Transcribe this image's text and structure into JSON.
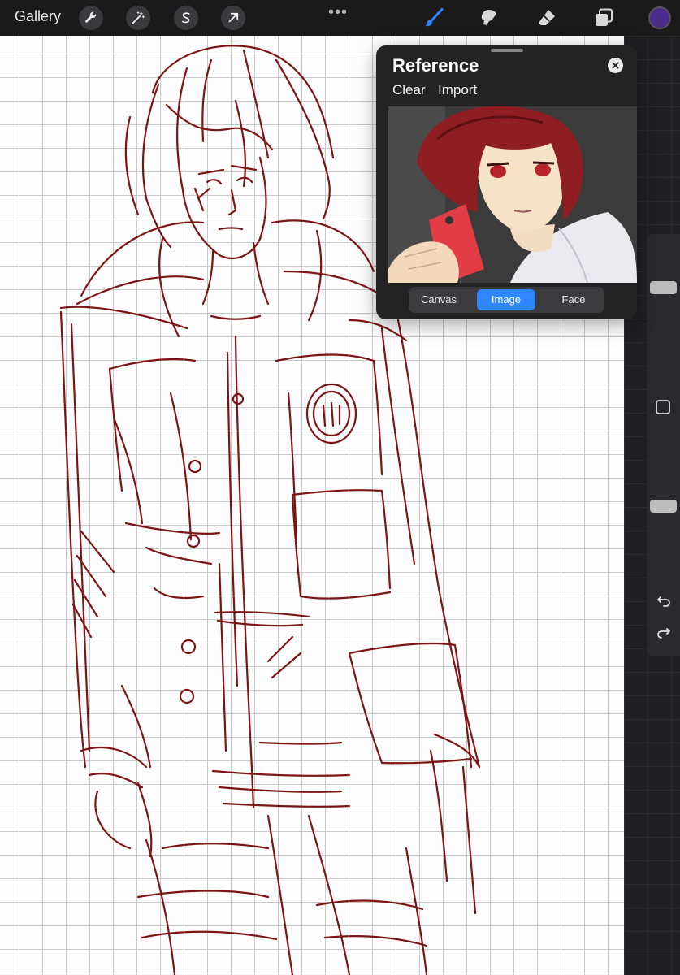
{
  "toolbar": {
    "gallery_label": "Gallery",
    "left_tools": [
      {
        "name": "wrench-icon"
      },
      {
        "name": "magic-wand-icon"
      },
      {
        "name": "selection-s-icon"
      },
      {
        "name": "transform-arrow-icon"
      }
    ],
    "more_label": "•••",
    "right_tools": [
      {
        "name": "brush-icon",
        "active": true
      },
      {
        "name": "smudge-icon",
        "active": false
      },
      {
        "name": "eraser-icon",
        "active": false
      },
      {
        "name": "layers-icon",
        "active": false
      }
    ],
    "current_color": "#4b2c8c"
  },
  "canvas": {
    "ink_color": "#7d1414"
  },
  "reference_panel": {
    "title": "Reference",
    "clear_label": "Clear",
    "import_label": "Import",
    "modes": [
      {
        "label": "Canvas",
        "active": false
      },
      {
        "label": "Image",
        "active": true
      },
      {
        "label": "Face",
        "active": false
      }
    ],
    "accent_color": "#2f86ff"
  },
  "sidebar": {
    "brush_size_level": 0.29,
    "brush_opacity_level": 0.55
  }
}
